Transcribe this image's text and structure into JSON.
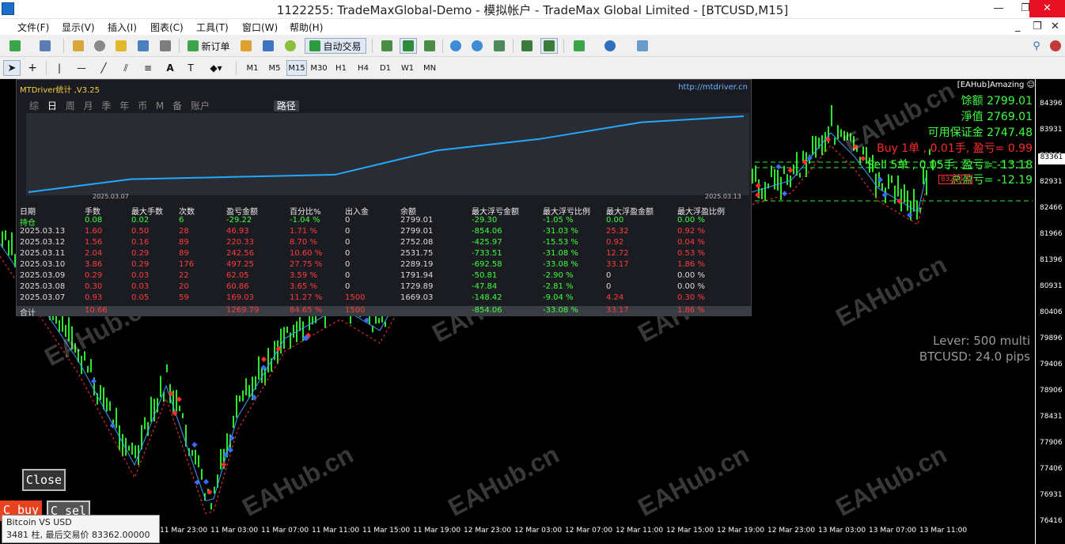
{
  "window": {
    "title": "1122255: TradeMaxGlobal-Demo - 模拟帐户 - TradeMax Global Limited - [BTCUSD,M15]",
    "min": "—",
    "max": "❐",
    "close": "✕"
  },
  "menu": [
    "文件(F)",
    "显示(V)",
    "插入(I)",
    "图表(C)",
    "工具(T)",
    "窗口(W)",
    "帮助(H)"
  ],
  "mdi_controls": {
    "min": "_",
    "restore": "❐",
    "close": "✕"
  },
  "toolbar": {
    "new_order": "新订单",
    "auto_trade": "自动交易"
  },
  "timeframes": [
    "M1",
    "M5",
    "M15",
    "M30",
    "H1",
    "H4",
    "D1",
    "W1",
    "MN"
  ],
  "active_timeframe": "M15",
  "panel": {
    "header": "MTDriver统计 ,V3.25",
    "url": "http://mtdriver.cn",
    "tabs": [
      "综",
      "日",
      "周",
      "月",
      "季",
      "年",
      "币",
      "M",
      "备",
      "账户"
    ],
    "tab_path": "路径",
    "date_start": "2025.03.07",
    "date_end": "2025.03.13",
    "equity_curve": [
      0,
      0.17,
      0.2,
      0.23,
      0.55,
      0.7,
      0.92,
      1.0
    ],
    "columns": [
      "日期",
      "手数",
      "最大手数",
      "次数",
      "盈亏金额",
      "百分比%",
      "出入金",
      "余额",
      "最大浮亏金额",
      "最大浮亏比例",
      "最大浮盈金额",
      "最大浮盈比例"
    ],
    "rows": [
      [
        "持仓",
        "0.08",
        "0.02",
        "6",
        "-29.22",
        "-1.04 %",
        "0",
        "2799.01",
        "-29.30",
        "-1.05 %",
        "0.00",
        "0.00 %"
      ],
      [
        "2025.03.13",
        "1.60",
        "0.50",
        "28",
        "46.93",
        "1.71 %",
        "0",
        "2799.01",
        "-854.06",
        "-31.03 %",
        "25.32",
        "0.92 %"
      ],
      [
        "2025.03.12",
        "1.56",
        "0.16",
        "89",
        "220.33",
        "8.70 %",
        "0",
        "2752.08",
        "-425.97",
        "-15.53 %",
        "0.92",
        "0.04 %"
      ],
      [
        "2025.03.11",
        "2.04",
        "0.29",
        "89",
        "242.56",
        "10.60 %",
        "0",
        "2531.75",
        "-733.51",
        "-31.08 %",
        "12.72",
        "0.53 %"
      ],
      [
        "2025.03.10",
        "3.86",
        "0.29",
        "176",
        "497.25",
        "27.75 %",
        "0",
        "2289.19",
        "-692.58",
        "-33.08 %",
        "33.17",
        "1.86 %"
      ],
      [
        "2025.03.09",
        "0.29",
        "0.03",
        "22",
        "62.05",
        "3.59 %",
        "0",
        "1791.94",
        "-50.81",
        "-2.90 %",
        "0",
        "0.00 %"
      ],
      [
        "2025.03.08",
        "0.30",
        "0.03",
        "20",
        "60.86",
        "3.65 %",
        "0",
        "1729.89",
        "-47.84",
        "-2.81 %",
        "0",
        "0.00 %"
      ],
      [
        "2025.03.07",
        "0.93",
        "0.05",
        "59",
        "169.03",
        "11.27 %",
        "1500",
        "1669.03",
        "-148.42",
        "-9.04 %",
        "4.24",
        "0.30 %"
      ]
    ],
    "total": [
      "合计",
      "10.66",
      "",
      "",
      "1269.79",
      "84.65 %",
      "1500",
      "",
      "-854.06",
      "-33.08 %",
      "33.17",
      "1.86 %"
    ]
  },
  "chart": {
    "tag": "[EAHub]Amazing ☺",
    "balance": "馀额 2799.01",
    "equity": "淨值 2769.01",
    "free_margin": "可用保证金 2747.48",
    "buy_line": "Buy 1单 , 0.01手, 盈亏= 0.99",
    "sell_line": "Sell 5单 , 0.05手, 盈亏= -13.18",
    "total_pl": "总盈亏= -12.19",
    "price_tag": "83294.0",
    "current_price": "83361",
    "lever": "Lever: 500 multi",
    "spread": "BTCUSD: 24.0 pips",
    "yticks": [
      "84396",
      "83931",
      "83361",
      "82931",
      "82466",
      "81966",
      "81396",
      "80931",
      "80406",
      "79896",
      "79406",
      "78906",
      "78431",
      "77906",
      "77406",
      "76931",
      "76416"
    ],
    "xticks": [
      "11 Mar 23:00",
      "11 Mar 03:00",
      "11 Mar 07:00",
      "11 Mar 11:00",
      "11 Mar 15:00",
      "11 Mar 19:00",
      "12 Mar 23:00",
      "12 Mar 03:00",
      "12 Mar 07:00",
      "12 Mar 11:00",
      "12 Mar 15:00",
      "12 Mar 19:00",
      "12 Mar 23:00",
      "13 Mar 03:00",
      "13 Mar 07:00",
      "13 Mar 11:00"
    ],
    "watermark": "EAHub.cn"
  },
  "buttons": {
    "close": "Close",
    "cbuy": "C buy",
    "csel": "C sel"
  },
  "tooltip": {
    "line1": "Bitcoin VS USD",
    "line2": "3481 柱, 最后交易价 83362.00000"
  }
}
